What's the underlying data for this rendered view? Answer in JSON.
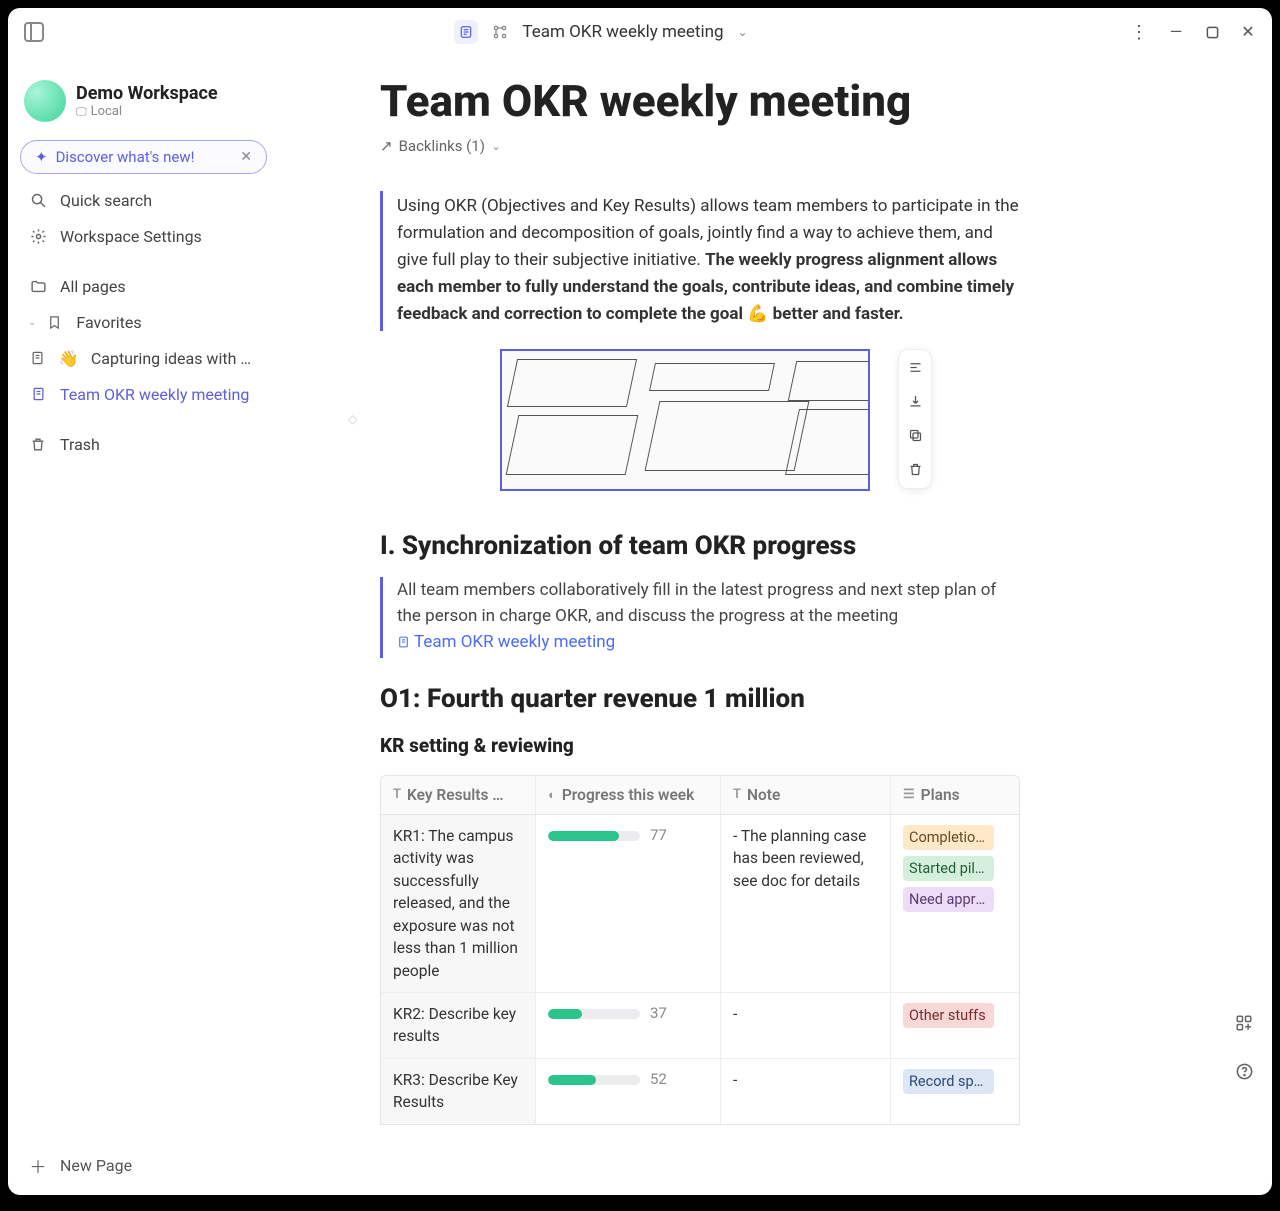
{
  "titlebar": {
    "tab_title": "Team OKR weekly meeting"
  },
  "workspace": {
    "name": "Demo Workspace",
    "location": "Local"
  },
  "discover": {
    "label": "Discover what's new!"
  },
  "sidebar": {
    "quick_search": "Quick search",
    "workspace_settings": "Workspace Settings",
    "all_pages": "All pages",
    "favorites": "Favorites",
    "items": [
      {
        "label": "Capturing ideas with AF…",
        "emoji": "👋"
      },
      {
        "label": "Team OKR weekly meeting"
      }
    ],
    "trash": "Trash",
    "new_page": "New Page"
  },
  "page": {
    "title": "Team OKR weekly meeting",
    "backlinks": "Backlinks (1)",
    "quote_plain": "Using OKR (Objectives and Key Results) allows team members to participate in the formulation and decomposition of goals, jointly find a way to achieve them, and give full play to their subjective initiative. ",
    "quote_bold": "The weekly progress alignment allows each member to fully understand the goals, contribute ideas, and combine timely feedback and correction to complete the goal 💪 better and faster."
  },
  "section1": {
    "heading": "I. Synchronization of team OKR progress",
    "para": "All team members collaboratively fill in the latest progress and next step plan of the person in charge OKR, and discuss the progress at the meeting ",
    "link_label": "Team OKR weekly meeting"
  },
  "objective": {
    "heading": "O1: Fourth quarter revenue 1 million",
    "sub": "KR setting & reviewing"
  },
  "table": {
    "headers": {
      "key": "Key Results …",
      "progress": "Progress this week",
      "note": "Note",
      "plans": "Plans"
    },
    "rows": [
      {
        "key": "KR1: The campus activity was successfully released, and the exposure was not less than 1 million people",
        "progress": 77,
        "note": "- The planning case has been reviewed, see doc for details",
        "plans": [
          {
            "text": "Completion of b",
            "cls": "tag-orange"
          },
          {
            "text": "Started piloting",
            "cls": "tag-green"
          },
          {
            "text": "Need approval o",
            "cls": "tag-purple"
          }
        ]
      },
      {
        "key": "KR2: Describe key results",
        "progress": 37,
        "note": "-",
        "plans": [
          {
            "text": "Other stuffs",
            "cls": "tag-red"
          }
        ]
      },
      {
        "key": "KR3: Describe Key Results",
        "progress": 52,
        "note": "-",
        "plans": [
          {
            "text": "Record specific i",
            "cls": "tag-blue"
          }
        ]
      }
    ]
  }
}
